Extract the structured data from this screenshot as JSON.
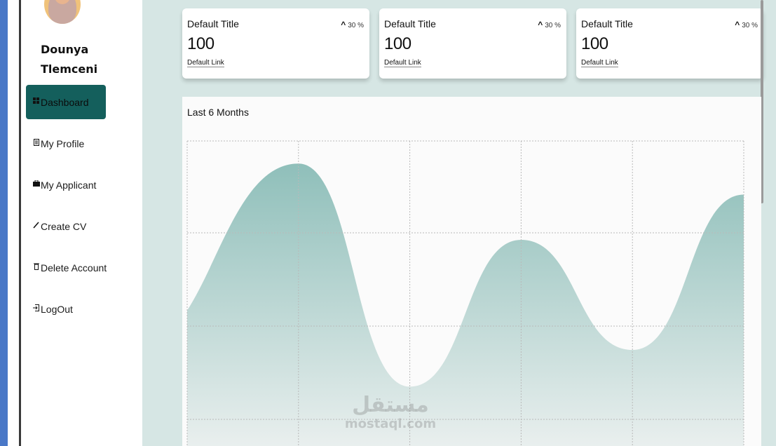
{
  "user": {
    "name": "Dounya Tlemceni"
  },
  "nav": {
    "items": [
      {
        "label": "Dashboard",
        "icon": "grid-icon",
        "active": true
      },
      {
        "label": "My Profile",
        "icon": "document-icon"
      },
      {
        "label": "My Applicant",
        "icon": "briefcase-icon"
      },
      {
        "label": "Create CV",
        "icon": "pencil-icon"
      },
      {
        "label": "Delete Account",
        "icon": "trash-icon"
      },
      {
        "label": "LogOut",
        "icon": "logout-icon"
      }
    ]
  },
  "cards": [
    {
      "title": "Default Title",
      "trend": "30 %",
      "value": "100",
      "link": "Default Link"
    },
    {
      "title": "Default Title",
      "trend": "30 %",
      "value": "100",
      "link": "Default Link"
    },
    {
      "title": "Default Title",
      "trend": "30 %",
      "value": "100",
      "link": "Default Link"
    }
  ],
  "chart_data": {
    "type": "area",
    "title": "Last 6 Months",
    "x": [
      0,
      1,
      2,
      3,
      4,
      5
    ],
    "values": [
      48,
      100,
      21,
      73,
      34,
      89
    ],
    "ylim": [
      0,
      108
    ],
    "grid": true,
    "fill_color": "#8fbfba",
    "xlabel": "",
    "ylabel": ""
  },
  "watermark": {
    "arabic": "مستقل",
    "latin": "mostaql.com"
  },
  "colors": {
    "accent": "#145f5c",
    "background": "#d6e6e4",
    "side_bar": "#4a78c7"
  }
}
